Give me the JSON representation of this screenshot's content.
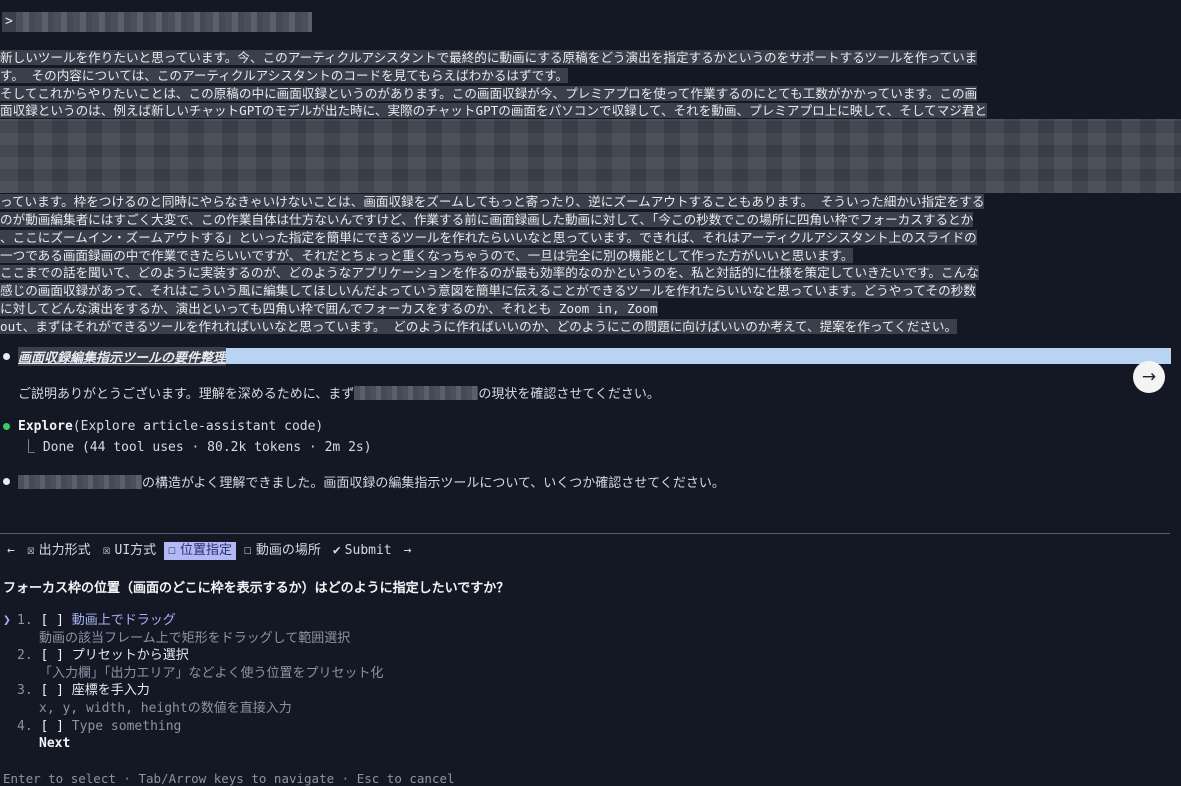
{
  "prompt": {
    "caret": ">"
  },
  "user_message": {
    "lines": [
      "新しいツールを作りたいと思っています。今、このアーティクルアシスタントで最終的に動画にする原稿をどう演出を指定するかというのをサポートするツールを作っていま",
      "す。 その内容については、このアーティクルアシスタントのコードを見てもらえばわかるはずです。",
      "そしてこれからやりたいことは、この原稿の中に画面収録というのがあります。この画面収録が今、プレミアプロを使って作業するのにとても工数がかかっています。この画",
      "面収録というのは、例えば新しいチャットGPTのモデルが出た時に、実際のチャットGPTの画面をパソコンで収録して、それを動画、プレミアプロ上に映して、そしてマジ君と"
    ],
    "lines_after": [
      "っています。枠をつけるのと同時にやらなきゃいけないことは、画面収録をズームしてもっと寄ったり、逆にズームアウトすることもあります。 そういった細かい指定をする",
      "のが動画編集者にはすごく大変で、この作業自体は仕方ないんですけど、作業する前に画面録画した動画に対して、「今この秒数でこの場所に四角い枠でフォーカスするとか",
      "、ここにズームイン・ズームアウトする」といった指定を簡単にできるツールを作れたらいいなと思っています。できれば、それはアーティクルアシスタント上のスライドの",
      "一つである画面録画の中で作業できたらいいですが、それだとちょっと重くなっちゃうので、一旦は完全に別の機能として作った方がいいと思います。",
      "ここまでの話を聞いて、どのように実装するのが、どのようなアプリケーションを作るのが最も効率的なのかというのを、私と対話的に仕様を策定していきたいです。こんな",
      "感じの画面収録があって、それはこういう風に編集してほしいんだよっていう意図を簡単に伝えることができるツールを作れたらいいなと思っています。どうやってその秒数",
      "に対してどんな演出をするか、演出といっても四角い枠で囲んでフォーカスをするのか、それとも Zoom in, Zoom",
      "out、まずはそれができるツールを作れればいいなと思っています。   どのように作ればいいのか、どのようにこの問題に向けばいいのか考えて、提案を作ってください。"
    ]
  },
  "assistant": {
    "heading": "画面収録編集指示ツールの要件整理",
    "reply1_before": "ご説明ありがとうございます。理解を深めるために、まず",
    "reply1_after": "の現状を確認させてください。",
    "explore_name": "Explore",
    "explore_arg": "(Explore article-assistant code)",
    "explore_done": "⎿ Done (44 tool uses · 80.2k tokens · 2m 2s)",
    "reply2_after": "の構造がよく理解できました。画面収録の編集指示ツールについて、いくつか確認させてください。"
  },
  "arrow_button": "→",
  "tabs": {
    "left_arrow": "←",
    "right_arrow": "→",
    "items": [
      {
        "box": "☒",
        "label": "出力形式"
      },
      {
        "box": "☒",
        "label": "UI方式"
      },
      {
        "box": "☐",
        "label": "位置指定"
      },
      {
        "box": "☐",
        "label": "動画の場所"
      },
      {
        "box": "✔",
        "label": "Submit"
      }
    ]
  },
  "question": "フォーカス枠の位置（画面のどこに枠を表示するか）はどのように指定したいですか？",
  "options": [
    {
      "cursor": "❯",
      "num": "1.",
      "check": "[ ]",
      "label": "動画上でドラッグ",
      "desc": "動画の該当フレーム上で矩形をドラッグして範囲選択"
    },
    {
      "cursor": "",
      "num": "2.",
      "check": "[ ]",
      "label": "プリセットから選択",
      "desc": "「入力欄」「出力エリア」などよく使う位置をプリセット化"
    },
    {
      "cursor": "",
      "num": "3.",
      "check": "[ ]",
      "label": "座標を手入力",
      "desc": "x, y, width, heightの数値を直接入力"
    },
    {
      "cursor": "",
      "num": "4.",
      "check": "[ ]",
      "label": "Type something",
      "desc": ""
    }
  ],
  "next_label": "Next",
  "footer": "Enter to select · Tab/Arrow keys to navigate · Esc to cancel"
}
